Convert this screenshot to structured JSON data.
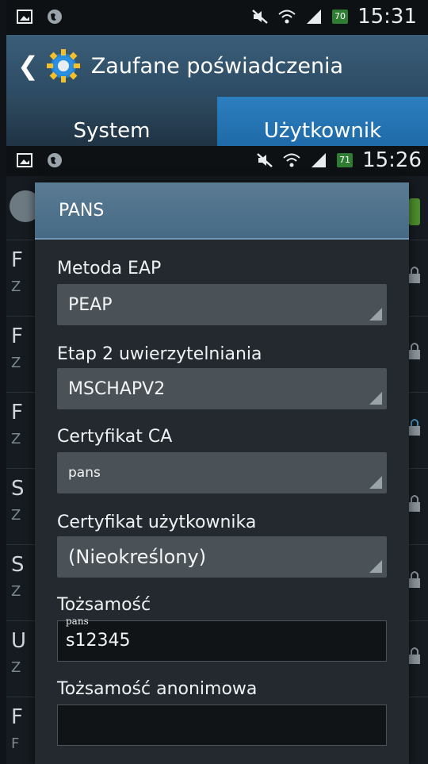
{
  "status_top": {
    "battery": "70",
    "time": "15:31"
  },
  "header": {
    "title": "Zaufane poświadczenia"
  },
  "tabs": [
    {
      "label": "System"
    },
    {
      "label": "Użytkownik"
    }
  ],
  "status_second": {
    "battery": "71",
    "time": "15:26"
  },
  "background_list": {
    "rows": [
      {
        "title": "F",
        "sub": "Z"
      },
      {
        "title": "F",
        "sub": "Z"
      },
      {
        "title": "F",
        "sub": "Z"
      },
      {
        "title": "S",
        "sub": "Z"
      },
      {
        "title": "S",
        "sub": "Z"
      },
      {
        "title": "U",
        "sub": "Z"
      },
      {
        "title": "F",
        "sub": "F"
      }
    ]
  },
  "dialog": {
    "title": "PANS",
    "eap_method": {
      "label": "Metoda EAP",
      "value": "PEAP"
    },
    "phase2": {
      "label": "Etap 2 uwierzytelniania",
      "value": "MSCHAPV2"
    },
    "ca_cert": {
      "label": "Certyfikat CA",
      "value": "pans"
    },
    "user_cert": {
      "label": "Certyfikat użytkownika",
      "value": "(Nieokreślony)"
    },
    "identity": {
      "label": "Tożsamość",
      "hint": "pans",
      "value": "s12345"
    },
    "anon_identity": {
      "label": "Tożsamość anonimowa",
      "value": ""
    }
  },
  "colors": {
    "action_bar": "#3b5e78",
    "tab_selected": "#2c7fbf",
    "dialog_head": "#5b7b93"
  }
}
